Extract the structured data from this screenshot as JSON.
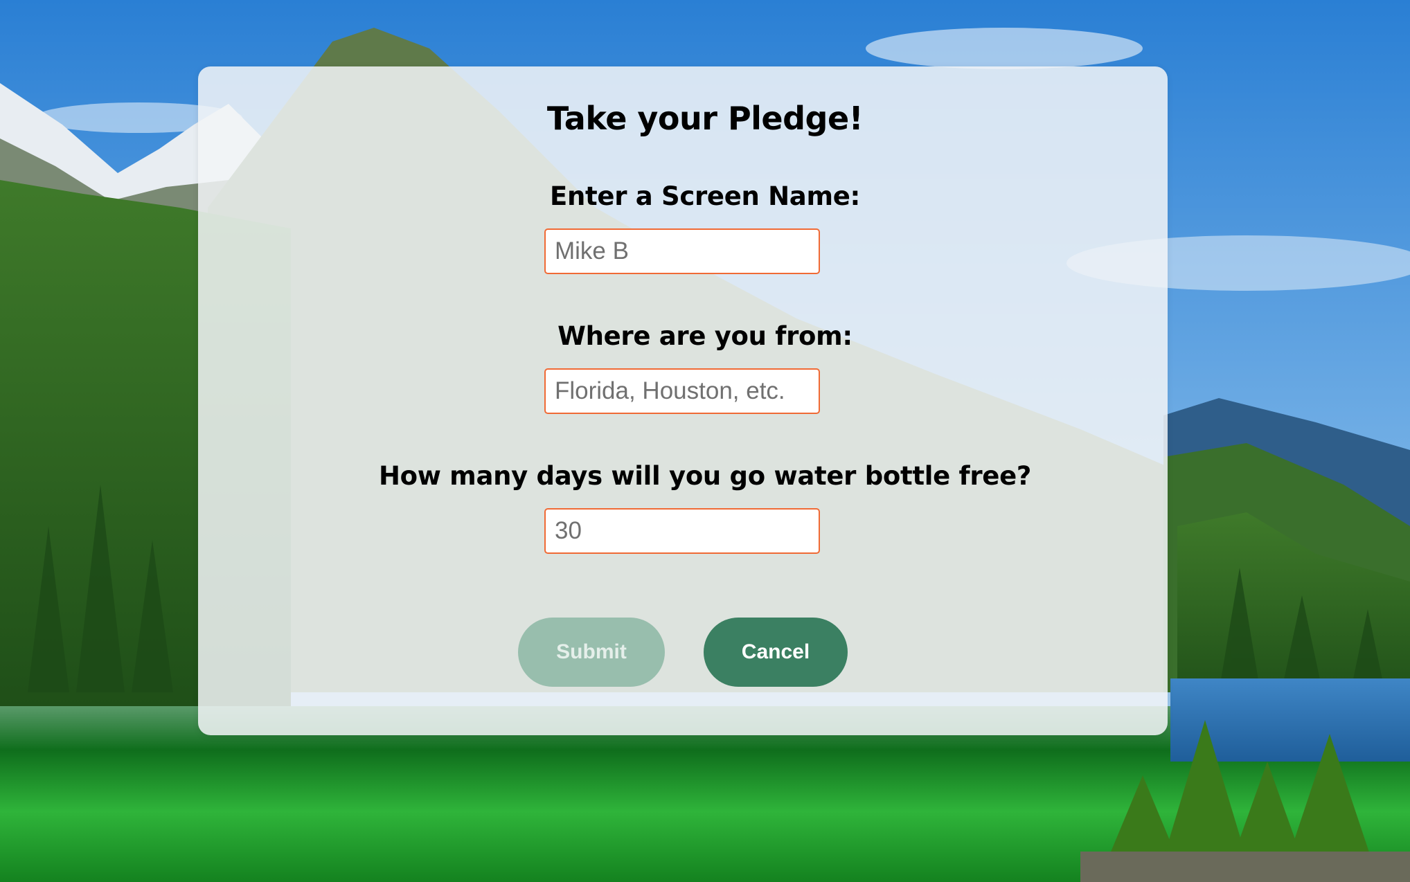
{
  "form": {
    "title": "Take your Pledge!",
    "screen_name": {
      "label": "Enter a Screen Name:",
      "placeholder": "Mike B"
    },
    "location": {
      "label": "Where are you from:",
      "placeholder": "Florida, Houston, etc."
    },
    "days": {
      "label": "How many days will you go water bottle free?",
      "placeholder": "30"
    },
    "buttons": {
      "submit_label": "Submit",
      "cancel_label": "Cancel"
    }
  },
  "colors": {
    "input_border": "#f06a35",
    "button_green": "#3b8062",
    "sky": "#3f8fd8",
    "lake": "#1f9a2c"
  }
}
